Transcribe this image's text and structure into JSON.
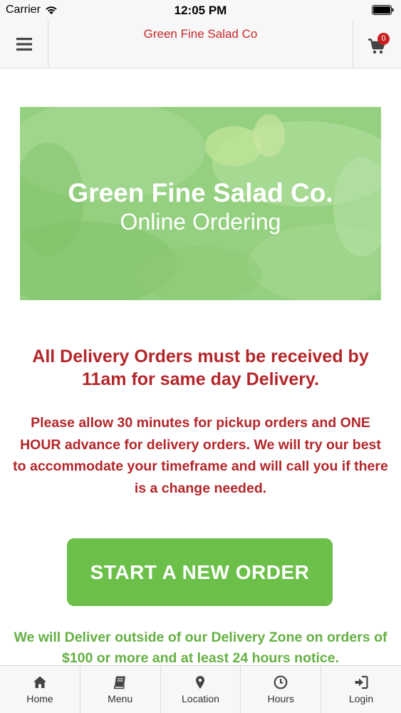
{
  "status_bar": {
    "carrier": "Carrier",
    "time": "12:05 PM"
  },
  "header": {
    "title": "Green Fine Salad Co",
    "menu_icon": "hamburger-icon",
    "cart_icon": "cart-icon",
    "cart_count": "0"
  },
  "banner": {
    "title": "Green Fine Salad Co.",
    "subtitle": "Online Ordering"
  },
  "notices": {
    "heading": "All Delivery Orders must be received by 11am for same day Delivery.",
    "body": "Please allow 30 minutes for pickup orders and ONE HOUR advance for delivery orders. We will try our best to accommodate your timeframe and will call you if there is a change needed."
  },
  "cta": {
    "start_order_label": "START A NEW ORDER"
  },
  "delivery_note": "We will Deliver outside of our Delivery Zone on orders of $100 or more and at least 24 hours notice.",
  "tabs": [
    {
      "label": "Home",
      "icon": "home-icon"
    },
    {
      "label": "Menu",
      "icon": "book-icon"
    },
    {
      "label": "Location",
      "icon": "map-pin-icon"
    },
    {
      "label": "Hours",
      "icon": "clock-icon"
    },
    {
      "label": "Login",
      "icon": "login-icon"
    }
  ],
  "colors": {
    "brand_red": "#c8262b",
    "notice_red": "#b3262a",
    "accent_green": "#6cc04a",
    "note_green": "#65b043",
    "banner_green": "#93cf80"
  }
}
